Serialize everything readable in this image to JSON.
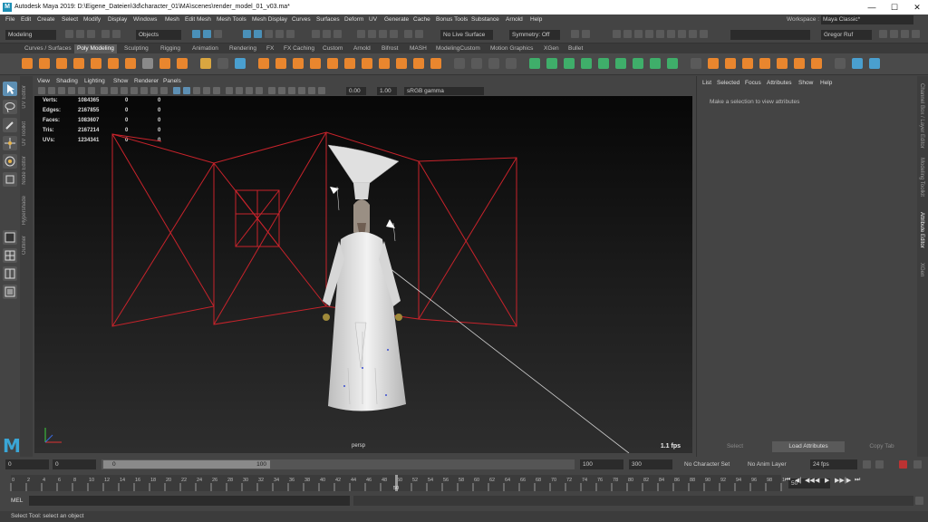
{
  "window": {
    "title": "Autodesk Maya 2019: D:\\Eigene_Dateien\\3d\\character_01\\MA\\scenes\\render_model_01_v03.ma*",
    "logo": "M",
    "min": "—",
    "max": "☐",
    "close": "✕"
  },
  "menubar": {
    "items": [
      "File",
      "Edit",
      "Create",
      "Select",
      "Modify",
      "Display",
      "Windows",
      "Mesh",
      "Edit Mesh",
      "Mesh Tools",
      "Mesh Display",
      "Curves",
      "Surfaces",
      "Deform",
      "UV",
      "Generate",
      "Cache",
      "Bonus Tools",
      "Substance",
      "Arnold",
      "Help"
    ],
    "workspace_label": "Workspace :",
    "workspace_value": "Maya Classic*"
  },
  "statusline": {
    "mode": "Modeling",
    "objects": "Objects",
    "live_surface": "No Live Surface",
    "symmetry": "Symmetry: Off",
    "user": "Gregor Ruf"
  },
  "shelf_tabs": {
    "items": [
      "Curves / Surfaces",
      "Poly Modeling",
      "Sculpting",
      "Rigging",
      "Animation",
      "Rendering",
      "FX",
      "FX Caching",
      "Custom",
      "Arnold",
      "Bifrost",
      "MASH",
      "ModelingCustom",
      "Motion Graphics",
      "XGen",
      "Bullet"
    ],
    "active": "Poly Modeling"
  },
  "side_tabs": [
    "UV Editor",
    "UV Toolkit",
    "Node Editor",
    "Hypershade",
    "Outliner"
  ],
  "panel_menu": [
    "View",
    "Shading",
    "Lighting",
    "Show",
    "Renderer",
    "Panels"
  ],
  "panel_toolbar": {
    "exposure": "0.00",
    "gamma": "1.00",
    "colorspace": "sRGB gamma"
  },
  "hud": {
    "rows": [
      {
        "label": "Verts:",
        "v1": "1084365",
        "v2": "0",
        "v3": "0"
      },
      {
        "label": "Edges:",
        "v1": "2167855",
        "v2": "0",
        "v3": "0"
      },
      {
        "label": "Faces:",
        "v1": "1083607",
        "v2": "0",
        "v3": "0"
      },
      {
        "label": "Tris:",
        "v1": "2167214",
        "v2": "0",
        "v3": "0"
      },
      {
        "label": "UVs:",
        "v1": "1234341",
        "v2": "0",
        "v3": "0"
      }
    ],
    "camera": "persp",
    "fps": "1.1 fps"
  },
  "attribute_editor": {
    "menu": [
      "List",
      "Selected",
      "Focus",
      "Attributes",
      "Show",
      "Help"
    ],
    "hint": "Make a selection to view attributes",
    "buttons": [
      "Select",
      "Load Attributes",
      "Copy Tab"
    ]
  },
  "right_tabs": [
    "Channel Box / Layer Editor",
    "Modeling Toolkit",
    "Attribute Editor",
    "XGen"
  ],
  "range": {
    "start": "0",
    "start2": "0",
    "slider_start": "0",
    "slider_end": "100",
    "end": "100",
    "end2": "300",
    "character_set": "No Character Set",
    "anim_layer": "No Anim Layer",
    "fps": "24 fps"
  },
  "timeline": {
    "ticks": [
      "0",
      "2",
      "4",
      "6",
      "8",
      "10",
      "12",
      "14",
      "16",
      "18",
      "20",
      "22",
      "24",
      "26",
      "28",
      "30",
      "32",
      "34",
      "36",
      "38",
      "40",
      "42",
      "44",
      "46",
      "48",
      "50",
      "52",
      "54",
      "56",
      "58",
      "60",
      "62",
      "64",
      "66",
      "68",
      "70",
      "72",
      "74",
      "76",
      "78",
      "80",
      "82",
      "84",
      "86",
      "88",
      "90",
      "92",
      "94",
      "96",
      "98",
      "100"
    ],
    "current_marker": "50",
    "current_field": "50"
  },
  "playback": {
    "buttons": [
      "⏮",
      "◀|",
      "◀◀",
      "◀",
      "▶",
      "▶▶",
      "|▶",
      "⏭"
    ]
  },
  "mel": {
    "label": "MEL"
  },
  "help": {
    "text": "Select Tool: select an object"
  },
  "colors": {
    "accent": "#5d8fb3",
    "wire": "#c8232b",
    "bg": "#444444"
  }
}
